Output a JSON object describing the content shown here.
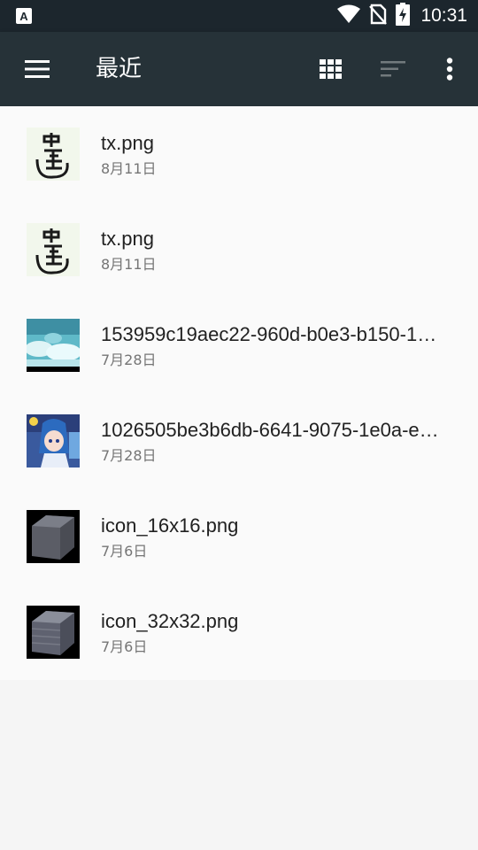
{
  "status_bar": {
    "time": "10:31",
    "left_icon": "accessibility-a-icon",
    "icons": [
      "wifi-icon",
      "no-sim-icon",
      "battery-charging-icon"
    ]
  },
  "app_bar": {
    "menu_icon": "hamburger-menu-icon",
    "title": "最近",
    "grid_icon": "grid-view-icon",
    "sort_icon": "sort-icon",
    "more_icon": "more-vert-icon"
  },
  "files": [
    {
      "name": "tx.png",
      "date": "8月11日",
      "thumbnail": "seal-calligraphy-thumbnail"
    },
    {
      "name": "tx.png",
      "date": "8月11日",
      "thumbnail": "seal-calligraphy-thumbnail"
    },
    {
      "name": "153959c19aec22-960d-b0e3-b150-1…",
      "date": "7月28日",
      "thumbnail": "anime-sky-thumbnail"
    },
    {
      "name": "1026505be3b6db-6641-9075-1e0a-e…",
      "date": "7月28日",
      "thumbnail": "anime-character-thumbnail"
    },
    {
      "name": "icon_16x16.png",
      "date": "7月6日",
      "thumbnail": "stone-block-thumbnail"
    },
    {
      "name": "icon_32x32.png",
      "date": "7月6日",
      "thumbnail": "stone-block-thumbnail"
    }
  ],
  "colors": {
    "status_bar_bg": "#1c262d",
    "app_bar_bg": "#263238",
    "list_bg": "#fafafa",
    "page_bg": "#f5f5f5"
  }
}
